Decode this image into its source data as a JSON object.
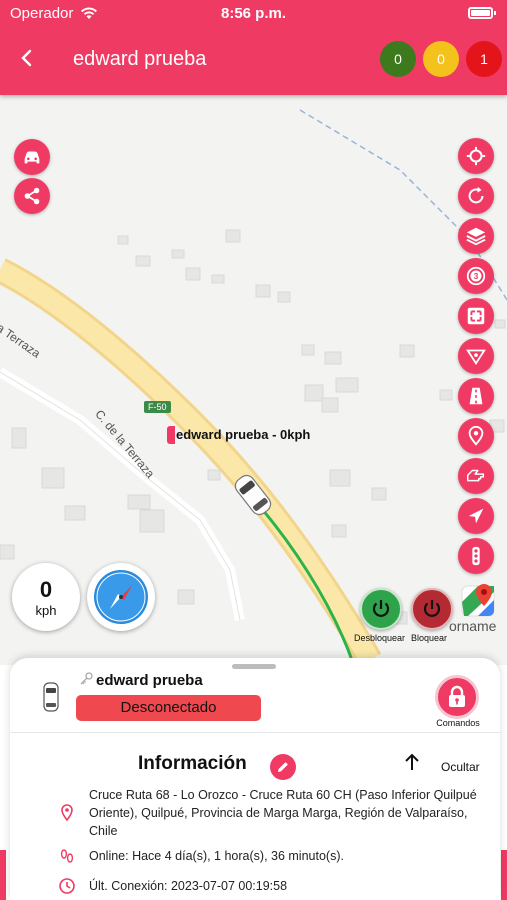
{
  "status_bar": {
    "carrier": "Operador",
    "time": "8:56 p.m."
  },
  "header": {
    "title": "edward prueba",
    "counters": [
      {
        "value": "0",
        "color": "#3d7a1e"
      },
      {
        "value": "0",
        "color": "#f4c21d"
      },
      {
        "value": "1",
        "color": "#e4141b"
      }
    ]
  },
  "map": {
    "street_labels": [
      "la Terraza",
      "C. de la Terraza"
    ],
    "road_badge": "F-50",
    "vehicle_label": "edward prueba - 0kph",
    "corner_text": "orname",
    "speed": {
      "value": "0",
      "unit": "kph"
    },
    "power_buttons": {
      "unlock_label": "Desbloquear",
      "lock_label": "Bloquear"
    },
    "right_buttons": [
      "crosshair-icon",
      "refresh-icon",
      "layers-icon",
      "timer-icon",
      "fit-screen-icon",
      "geofence-icon",
      "road-icon",
      "pin-icon",
      "hand-point-icon",
      "navigate-icon",
      "traffic-light-icon"
    ]
  },
  "panel": {
    "vehicle_name": "edward prueba",
    "status": "Desconectado",
    "commands_label": "Comandos",
    "info_title": "Información",
    "hide_label": "Ocultar",
    "address": "Cruce Ruta 68 - Lo Orozco - Cruce Ruta 60 CH (Paso Inferior Quilpué Oriente), Quilpué, Provincia de Marga Marga, Región de Valparaíso, Chile",
    "online": "Online: Hace 4 día(s), 1 hora(s), 36 minuto(s).",
    "last_connection": "Últ. Conexión: 2023-07-07 00:19:58"
  },
  "colors": {
    "accent": "#ef3a63",
    "status_red": "#f0484f"
  }
}
